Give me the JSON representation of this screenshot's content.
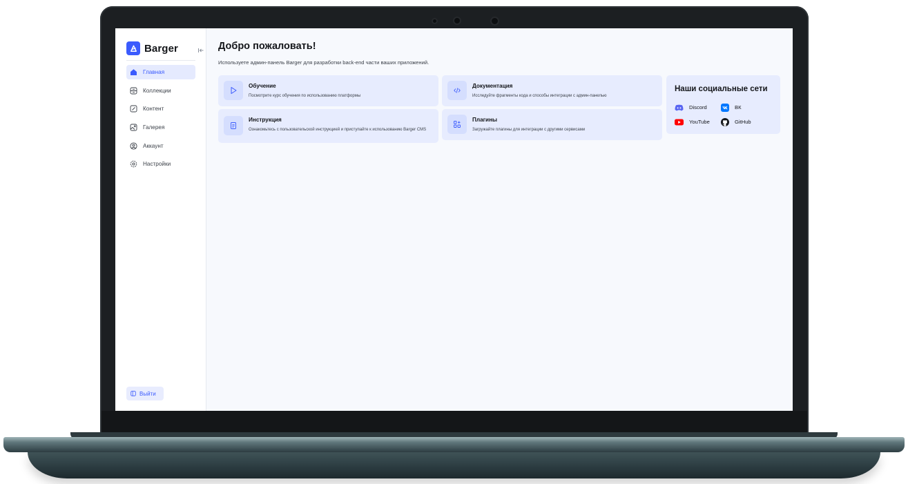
{
  "brand": {
    "name": "Barger",
    "accent_color": "#3b5bfd"
  },
  "sidebar": {
    "items": [
      {
        "label": "Главная",
        "icon": "home-icon",
        "active": true
      },
      {
        "label": "Коллекции",
        "icon": "database-icon",
        "active": false
      },
      {
        "label": "Контент",
        "icon": "edit-icon",
        "active": false
      },
      {
        "label": "Галерея",
        "icon": "image-icon",
        "active": false
      },
      {
        "label": "Аккаунт",
        "icon": "user-icon",
        "active": false
      },
      {
        "label": "Настройки",
        "icon": "gear-icon",
        "active": false
      }
    ],
    "logout_label": "Выйти"
  },
  "main": {
    "title": "Добро пожаловать!",
    "subtitle": "Используете админ-панель Barger для разработки back-end части ваших приложений.",
    "cards": [
      {
        "title": "Обучение",
        "description": "Посмотрите курс обучения по использованию платформы",
        "icon": "play-icon"
      },
      {
        "title": "Документация",
        "description": "Исследуйте фрагменты кода и способы интеграции с админ-панелью",
        "icon": "code-icon"
      },
      {
        "title": "Инструкция",
        "description": "Ознакомьтесь с пользовательской инструкцией и приступайте к использованию Barger CMS",
        "icon": "document-icon"
      },
      {
        "title": "Плагины",
        "description": "Загружайте плагины для интеграции с другими сервисами",
        "icon": "plugins-icon"
      }
    ]
  },
  "social": {
    "title": "Наши социальные сети",
    "items": [
      {
        "label": "Discord",
        "icon": "discord-icon",
        "color": "#5865f2"
      },
      {
        "label": "ВК",
        "icon": "vk-icon",
        "color": "#0077ff"
      },
      {
        "label": "YouTube",
        "icon": "youtube-icon",
        "color": "#ff0000"
      },
      {
        "label": "GitHub",
        "icon": "github-icon",
        "color": "#14161a"
      }
    ]
  }
}
